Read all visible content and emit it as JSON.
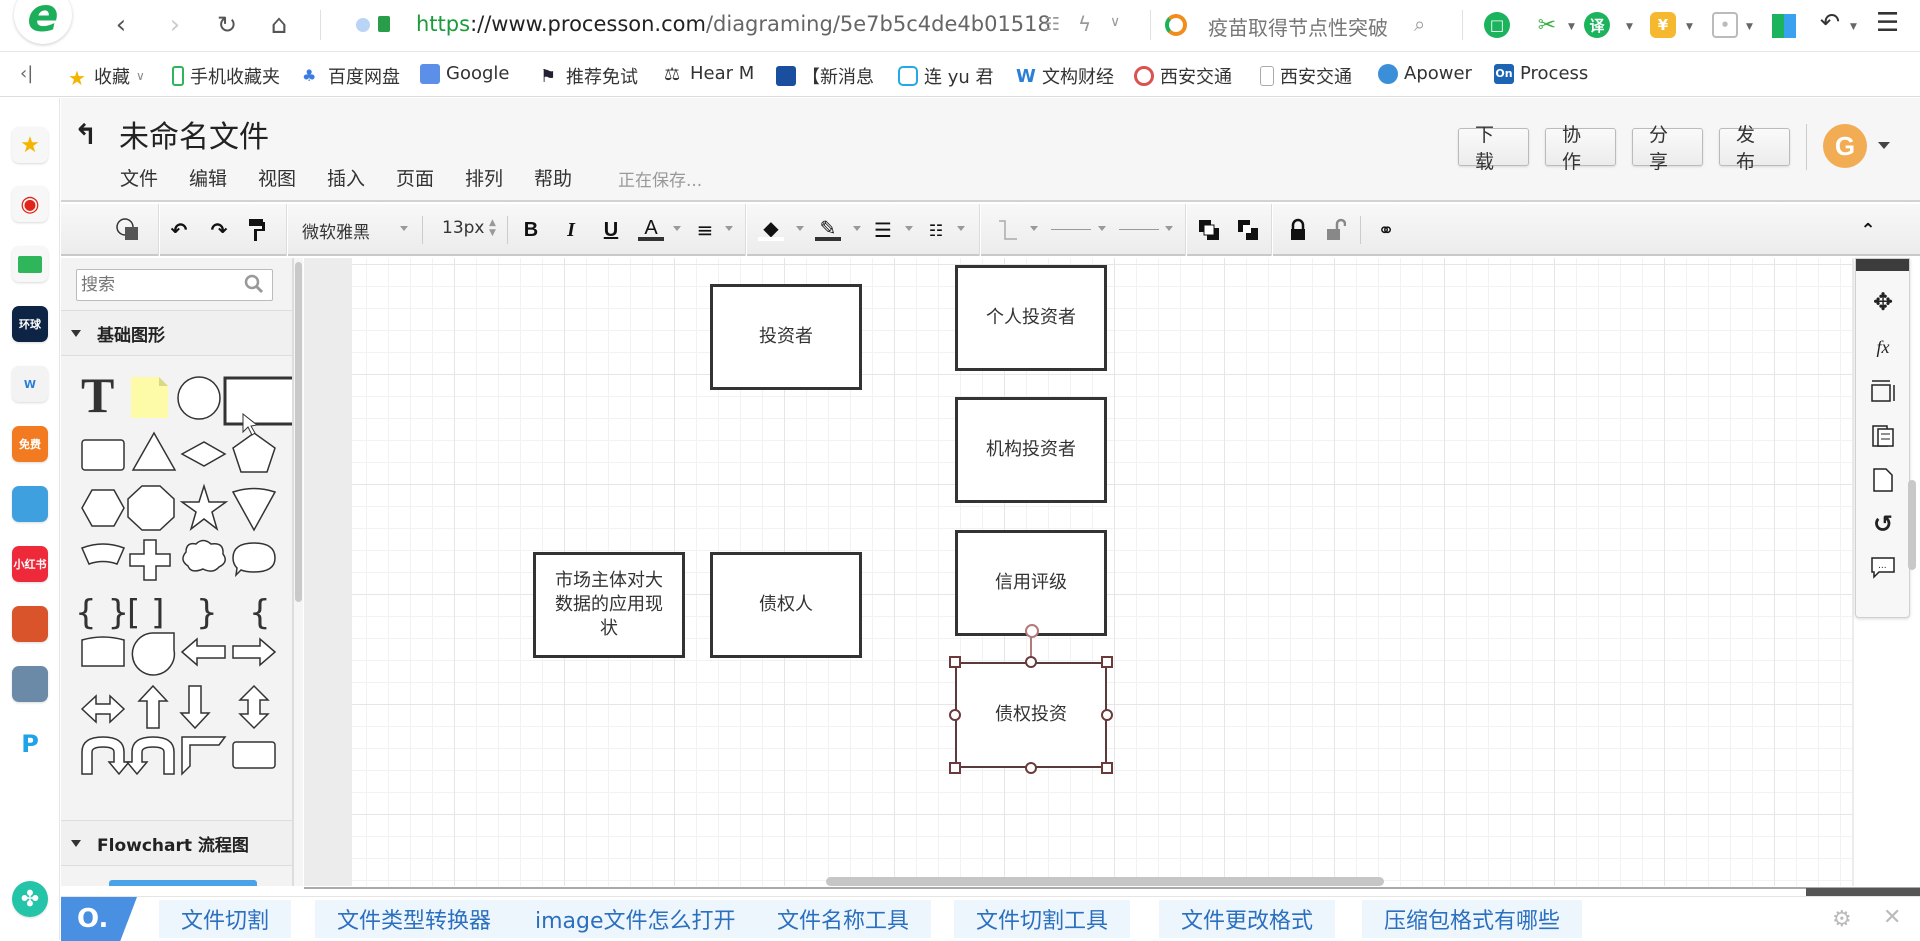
{
  "browser": {
    "url_scheme": "https",
    "url_host": "://www.processon.com",
    "url_path": "/diagraming/5e7b5c4de4b01518",
    "search_text": "疫苗取得节点性突破",
    "icons": [
      "back-icon",
      "forward-icon",
      "reload-icon",
      "home-icon",
      "qr-icon",
      "lightning-icon",
      "search-icon",
      "reader-icon",
      "scissors-icon",
      "translate-icon",
      "coupon-icon",
      "game-icon",
      "apps-icon",
      "undo-icon",
      "menu-icon"
    ]
  },
  "bookmarks": [
    {
      "label": "收藏",
      "icon": "star-icon"
    },
    {
      "label": "手机收藏夹",
      "icon": "phone-icon"
    },
    {
      "label": "百度网盘",
      "icon": "baidu-cloud-icon"
    },
    {
      "label": "Google",
      "icon": "google-translate-icon"
    },
    {
      "label": "推荐免试",
      "icon": "graduation-cap-icon"
    },
    {
      "label": "Hear M",
      "icon": "microscope-icon"
    },
    {
      "label": "【新消息",
      "icon": "chart-icon"
    },
    {
      "label": "连 yu 君",
      "icon": "bilibili-icon"
    },
    {
      "label": "文构财经",
      "icon": "w-icon"
    },
    {
      "label": "西安交通",
      "icon": "university-icon"
    },
    {
      "label": "西安交通",
      "icon": "page-icon"
    },
    {
      "label": "Apower",
      "icon": "camera-icon"
    },
    {
      "label": "Process",
      "icon": "processon-icon"
    }
  ],
  "rail": [
    "favorites",
    "weibo",
    "mail",
    "huanqiu-wangxiao",
    "word-doc",
    "free-novel",
    "game-a",
    "xiaohongshu",
    "game-b",
    "game-c",
    "pdf-tool",
    "add-app"
  ],
  "app": {
    "title": "未命名文件",
    "menus": [
      "文件",
      "编辑",
      "视图",
      "插入",
      "页面",
      "排列",
      "帮助"
    ],
    "status": "正在保存...",
    "buttons": [
      "下载",
      "协作",
      "分享",
      "发布"
    ],
    "avatar_letter": "G",
    "avatar_color": "#f2ad54"
  },
  "toolbar": {
    "font_family": "微软雅黑",
    "font_size": "13px"
  },
  "sidebar": {
    "search_placeholder": "搜索",
    "sections": [
      {
        "title": "基础图形",
        "expanded": true
      },
      {
        "title": "Flowchart 流程图",
        "expanded": true
      }
    ]
  },
  "canvas": {
    "nodes": [
      {
        "id": "investor",
        "text": "投资者"
      },
      {
        "id": "individual-investor",
        "text": "个人投资者"
      },
      {
        "id": "institutional-investor",
        "text": "机构投资者"
      },
      {
        "id": "market-status",
        "text": "市场主体对大数据的应用现状"
      },
      {
        "id": "creditor",
        "text": "债权人"
      },
      {
        "id": "credit-rating",
        "text": "信用评级"
      },
      {
        "id": "debt-investment",
        "text": "债权投资",
        "selected": true
      }
    ]
  },
  "bottom_bar": {
    "chips": [
      "文件切割",
      "文件类型转换器",
      "image文件怎么打开",
      "文件名称工具",
      "文件切割工具",
      "文件更改格式",
      "压缩包格式有哪些"
    ]
  }
}
